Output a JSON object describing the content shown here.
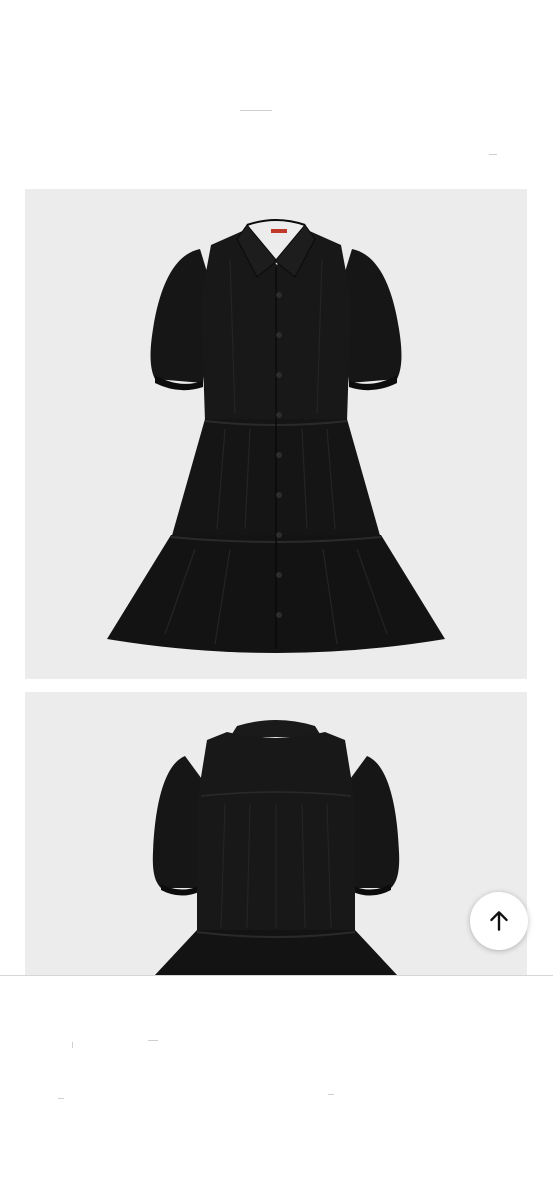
{
  "page": {
    "background": "#ffffff",
    "photo_background": "#ececec",
    "garment_color": "#141414"
  },
  "product_images": [
    {
      "view": "front",
      "brand_label_color": "#c0392b"
    },
    {
      "view": "back"
    }
  ],
  "scroll_top": {
    "icon": "arrow-up-icon"
  }
}
